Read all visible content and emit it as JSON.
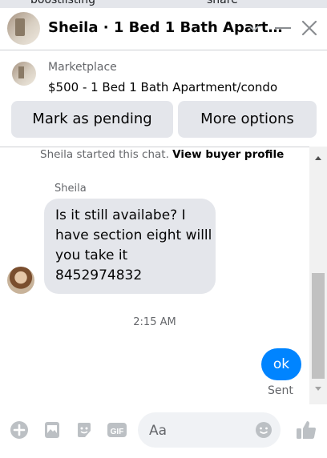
{
  "top_strip": {
    "left_fragment": "boostlisting",
    "right_fragment": "share"
  },
  "header": {
    "title": "Sheila · 1 Bed 1 Bath Apart…",
    "icons": [
      "avatar",
      "chevron-down-icon",
      "minimize-icon",
      "close-icon"
    ]
  },
  "marketplace": {
    "source": "Marketplace",
    "item": "$500 - 1 Bed 1 Bath Apartment/condo",
    "buttons": {
      "mark_pending": "Mark as pending",
      "more_options": "More options"
    }
  },
  "chat": {
    "started_text": "Sheila started this chat.",
    "profile_link": "View buyer profile",
    "sender": "Sheila",
    "message_lines": [
      "Is it still availabe? I",
      "have section eight willl",
      "you take it",
      "8452974832"
    ],
    "timestamp": "2:15 AM",
    "reply": "ok",
    "reply_status": "Sent"
  },
  "composer": {
    "placeholder": "Aa",
    "icons": [
      "plus-icon",
      "image-icon",
      "sticker-icon",
      "gif-icon",
      "emoji-icon",
      "like-icon"
    ],
    "gif_label": "GIF"
  },
  "colors": {
    "accent": "#0084ff",
    "icon_grey": "#bcc0c4",
    "bubble": "#e4e6eb",
    "muted": "#65676b"
  }
}
